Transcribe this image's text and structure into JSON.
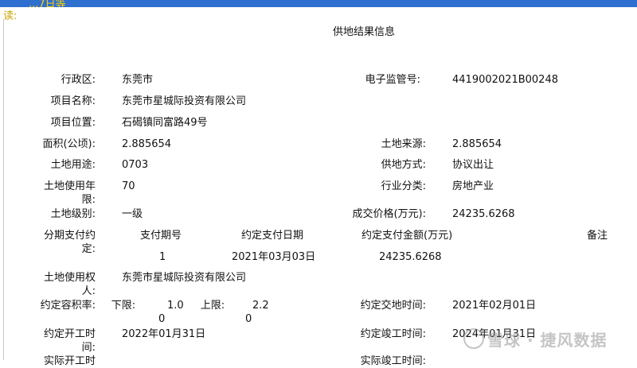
{
  "header": {
    "clipped_title": "...7日等",
    "read_label": "读:"
  },
  "title": "供地结果信息",
  "fields": {
    "district_label": "行政区:",
    "district": "东莞市",
    "supervision_label": "电子监管号:",
    "supervision": "4419002021B00248",
    "project_name_label": "项目名称:",
    "project_name": "东莞市星城际投资有限公司",
    "project_location_label": "项目位置:",
    "project_location": "石碣镇同富路49号",
    "area_label": "面积(公顷):",
    "area": "2.885654",
    "land_source_label": "土地来源:",
    "land_source": "2.885654",
    "land_use_label": "土地用途:",
    "land_use": "0703",
    "supply_method_label": "供地方式:",
    "supply_method": "协议出让",
    "use_years_label": "土地使用年限:",
    "use_years": "70",
    "industry_label": "行业分类:",
    "industry": "房地产业",
    "land_grade_label": "土地级别:",
    "land_grade": "一级",
    "deal_price_label": "成交价格(万元):",
    "deal_price": "24235.6268",
    "installment_label": "分期支付约定:",
    "pay_period_header": "支付期号",
    "pay_date_header": "约定支付日期",
    "pay_amount_header": "约定支付金额(万元)",
    "remark_header": "备注",
    "pay_period": "1",
    "pay_date": "2021年03月03日",
    "pay_amount": "24235.6268",
    "land_user_label": "土地使用权人:",
    "land_user": "东莞市星城际投资有限公司",
    "plot_ratio_label": "约定容积率:",
    "lower_label": "下限:",
    "lower_value": "1.0",
    "upper_label": "上限:",
    "upper_value": "2.2",
    "lower_zero": "0",
    "upper_zero": "0",
    "handover_label": "约定交地时间:",
    "handover": "2021年02月01日",
    "start_label": "约定开工时间:",
    "start": "2022年01月31日",
    "completion_label": "约定竣工时间:",
    "completion": "2024年01月31日",
    "actual_start_label": "实际开工时",
    "actual_completion_label": "实际竣工时间:"
  },
  "watermark": "雪球 · 捷风数据"
}
